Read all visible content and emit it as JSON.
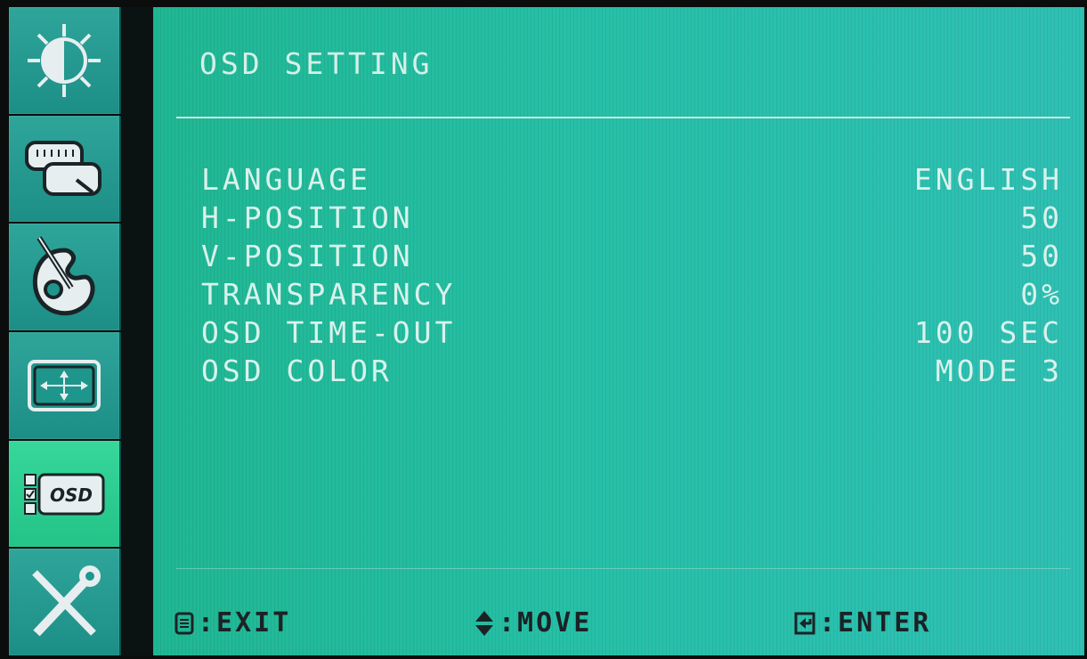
{
  "osd": {
    "title": "OSD SETTING",
    "settings": [
      {
        "label": "LANGUAGE",
        "value": "ENGLISH"
      },
      {
        "label": "H-POSITION",
        "value": "50"
      },
      {
        "label": "V-POSITION",
        "value": "50"
      },
      {
        "label": "TRANSPARENCY",
        "value": "0%"
      },
      {
        "label": "OSD TIME-OUT",
        "value": "100 SEC"
      },
      {
        "label": "OSD COLOR",
        "value": "MODE 3"
      }
    ]
  },
  "sidebar": {
    "items": [
      {
        "icon": "brightness-icon",
        "active": false
      },
      {
        "icon": "input-source-icon",
        "active": false
      },
      {
        "icon": "color-palette-icon",
        "active": false
      },
      {
        "icon": "image-position-icon",
        "active": false
      },
      {
        "icon": "osd-settings-icon",
        "label": "OSD",
        "active": true
      },
      {
        "icon": "tools-icon",
        "active": false
      }
    ]
  },
  "hints": {
    "exit": ":EXIT",
    "move": ":MOVE",
    "enter": ":ENTER"
  },
  "colors": {
    "panel": "#26c0a7",
    "sidebar": "#1f968c",
    "active_tab": "#2fd593",
    "text": "#d9f2ec",
    "hint_text": "#1b2226"
  }
}
